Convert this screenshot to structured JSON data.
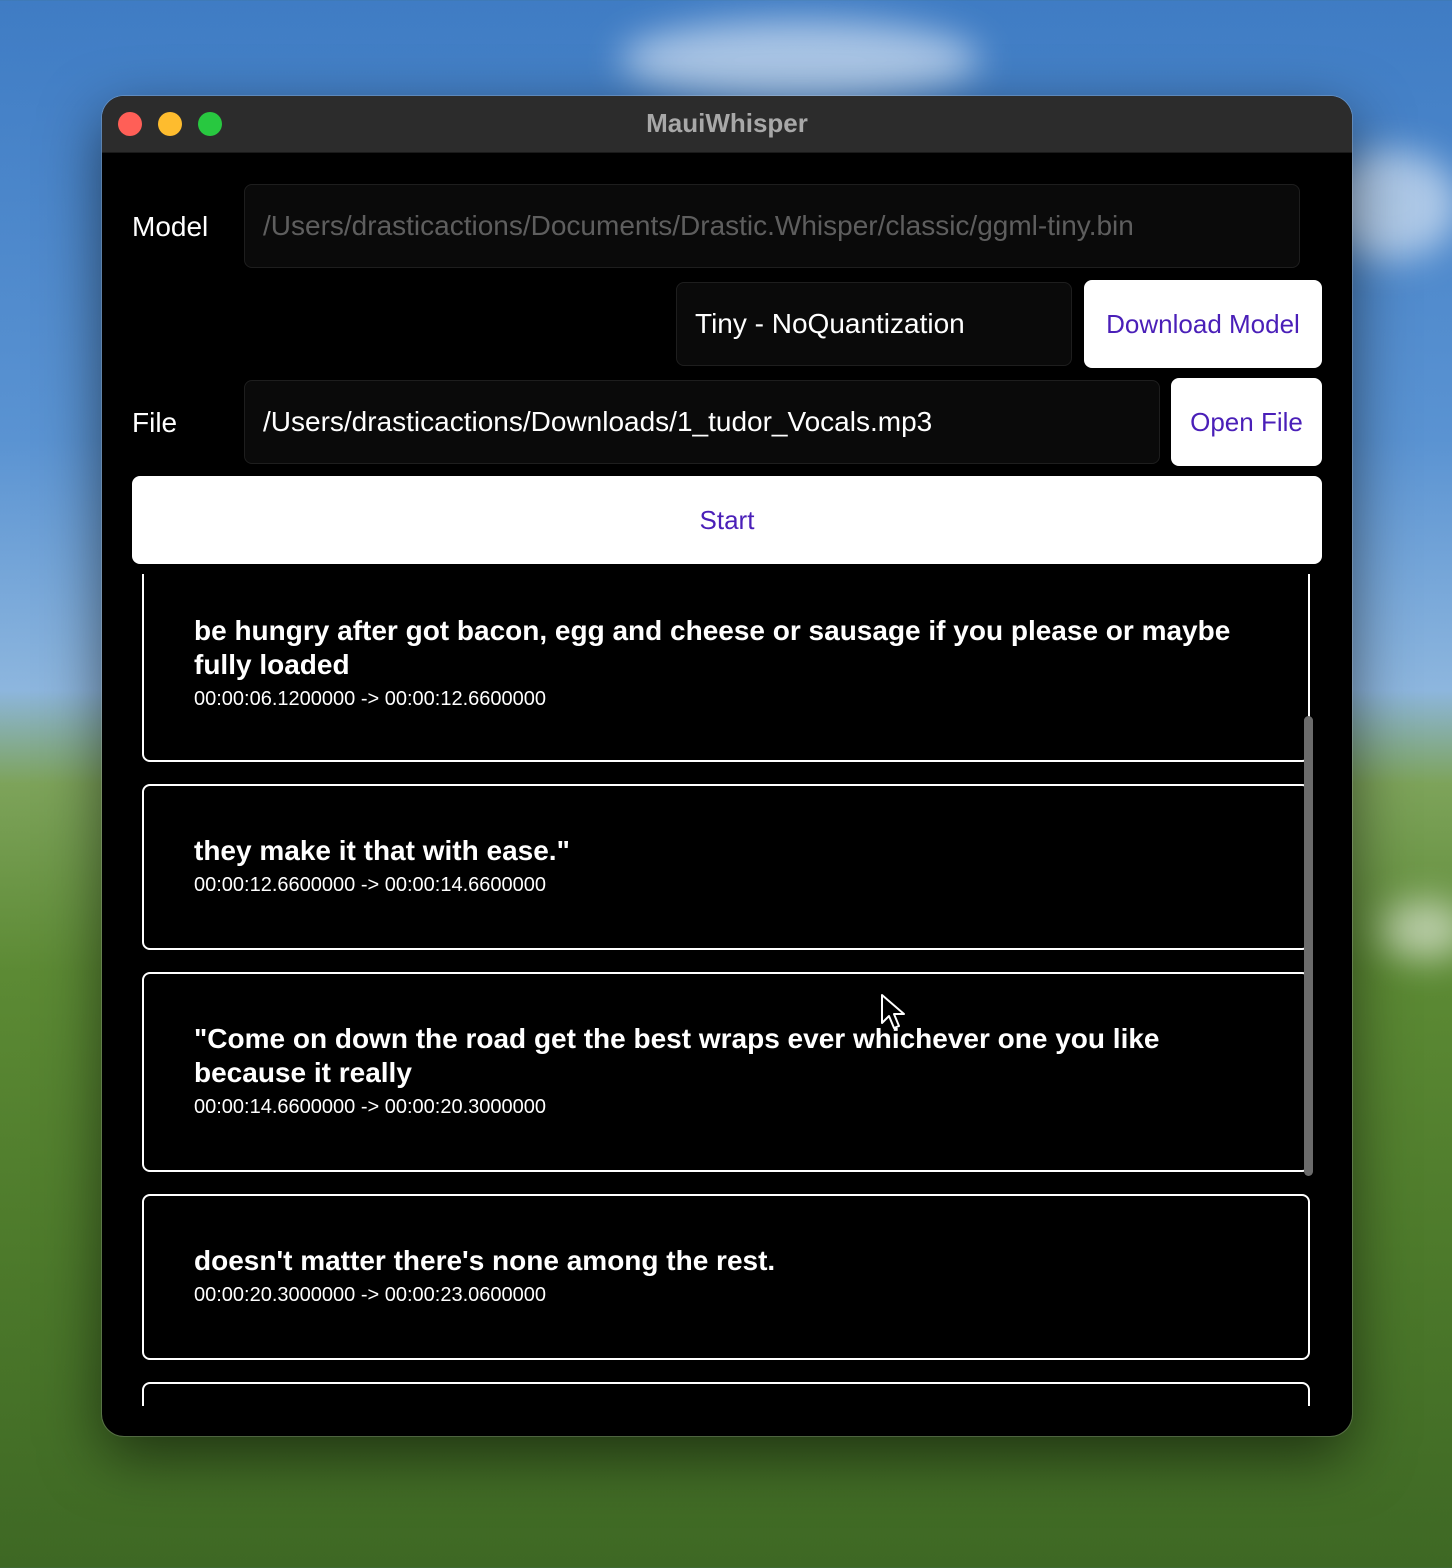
{
  "window": {
    "title": "MauiWhisper"
  },
  "model": {
    "label": "Model",
    "path_placeholder": "/Users/drasticactions/Documents/Drastic.Whisper/classic/ggml-tiny.bin",
    "selected_model": "Tiny - NoQuantization",
    "download_label": "Download Model"
  },
  "file": {
    "label": "File",
    "path": "/Users/drasticactions/Downloads/1_tudor_Vocals.mp3",
    "open_label": "Open File"
  },
  "start_label": "Start",
  "segments": [
    {
      "text": "be hungry after got bacon, egg and cheese or sausage if you please or maybe fully loaded",
      "time": "00:00:06.1200000 -> 00:00:12.6600000"
    },
    {
      "text": "they make it that with ease.\"",
      "time": "00:00:12.6600000 -> 00:00:14.6600000"
    },
    {
      "text": "\"Come on down the road get the best wraps ever whichever one you like because it really",
      "time": "00:00:14.6600000 -> 00:00:20.3000000"
    },
    {
      "text": "doesn't matter there's none among the rest.",
      "time": "00:00:20.3000000 -> 00:00:23.0600000"
    }
  ],
  "colors": {
    "accent": "#4a1fb8",
    "window_bg": "#000000",
    "titlebar": "#2c2c2c"
  },
  "icons": [
    "close-window-icon",
    "minimize-window-icon",
    "maximize-window-icon",
    "mouse-pointer-icon"
  ]
}
